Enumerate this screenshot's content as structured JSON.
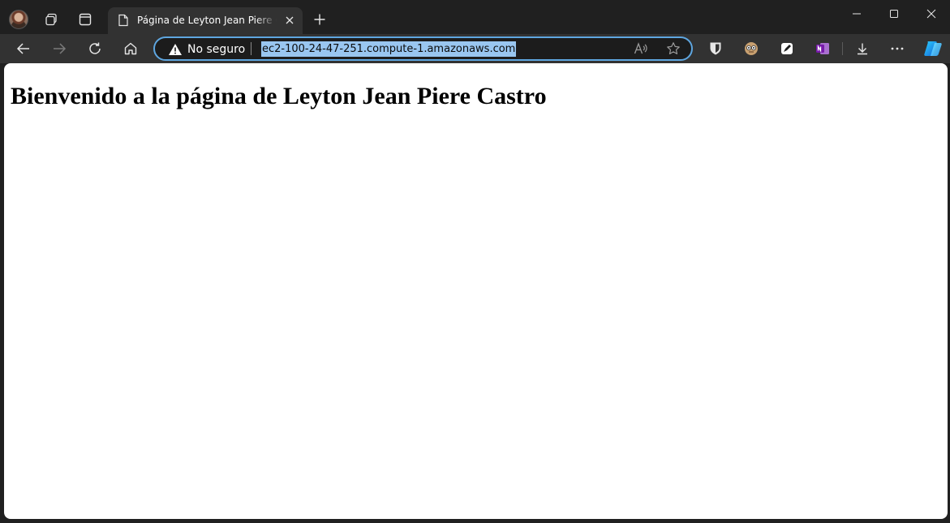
{
  "browser": {
    "tab": {
      "title": "Página de Leyton Jean Piere Castro"
    },
    "address_bar": {
      "security_label": "No seguro",
      "url": "ec2-100-24-47-251.compute-1.amazonaws.com"
    },
    "icons": {
      "profile": "avatar",
      "workspaces": "workspaces-icon",
      "tab_actions": "tab-actions-icon",
      "back": "back-arrow-icon",
      "forward": "forward-arrow-icon",
      "refresh": "refresh-icon",
      "home": "home-icon",
      "warning": "warning-icon",
      "read_aloud": "read-aloud-icon",
      "favorite": "star-icon",
      "extensions": [
        "bitwarden-icon",
        "extension-face-icon",
        "editor-extension-icon",
        "onenote-icon"
      ],
      "downloads": "download-icon",
      "more": "more-icon",
      "copilot": "copilot-icon"
    },
    "colors": {
      "accent": "#5ea6e0",
      "url_selection": "#99c6f0",
      "chrome_dark": "#202020",
      "toolbar": "#323232"
    }
  },
  "page": {
    "heading": "Bienvenido a la página de Leyton Jean Piere Castro"
  }
}
